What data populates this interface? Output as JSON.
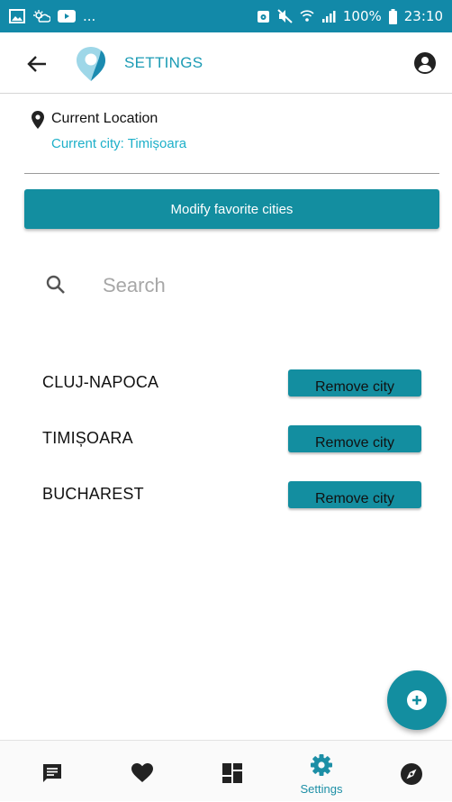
{
  "status_bar": {
    "left_text": "...",
    "battery": "100%",
    "time": "23:10",
    "icons": [
      "gallery-icon",
      "weather-icon",
      "youtube-icon",
      "alarm-icon",
      "mute-icon",
      "wifi-icon",
      "signal-icon",
      "battery-icon"
    ]
  },
  "app_bar": {
    "title": "SETTINGS",
    "icons": [
      "back-arrow-icon",
      "app-logo-icon",
      "account-circle-icon"
    ]
  },
  "location": {
    "label": "Current Location",
    "city_text": "Current city: Timișoara",
    "icon": "location-pin-icon"
  },
  "modify_button": {
    "label": "Modify favorite cities"
  },
  "search": {
    "placeholder": "Search",
    "value": "",
    "icon": "search-icon"
  },
  "cities": [
    {
      "name": "CLUJ-NAPOCA",
      "button": "Remove city"
    },
    {
      "name": "TIMIȘOARA",
      "button": "Remove city"
    },
    {
      "name": "BUCHAREST",
      "button": "Remove city"
    }
  ],
  "fab": {
    "icon": "add-circle-icon"
  },
  "bottom_nav": {
    "items": [
      {
        "id": "chat",
        "icon": "chat-icon",
        "label": ""
      },
      {
        "id": "favorites",
        "icon": "heart-icon",
        "label": ""
      },
      {
        "id": "dashboard",
        "icon": "dashboard-icon",
        "label": ""
      },
      {
        "id": "settings",
        "icon": "gear-icon",
        "label": "Settings",
        "active": true
      },
      {
        "id": "explore",
        "icon": "compass-icon",
        "label": ""
      }
    ]
  },
  "colors": {
    "status_bar": "#1289a8",
    "accent": "#1b9bb4",
    "button": "#138ea0",
    "city_text": "#1eb0c9",
    "icon_dark": "#222222"
  }
}
